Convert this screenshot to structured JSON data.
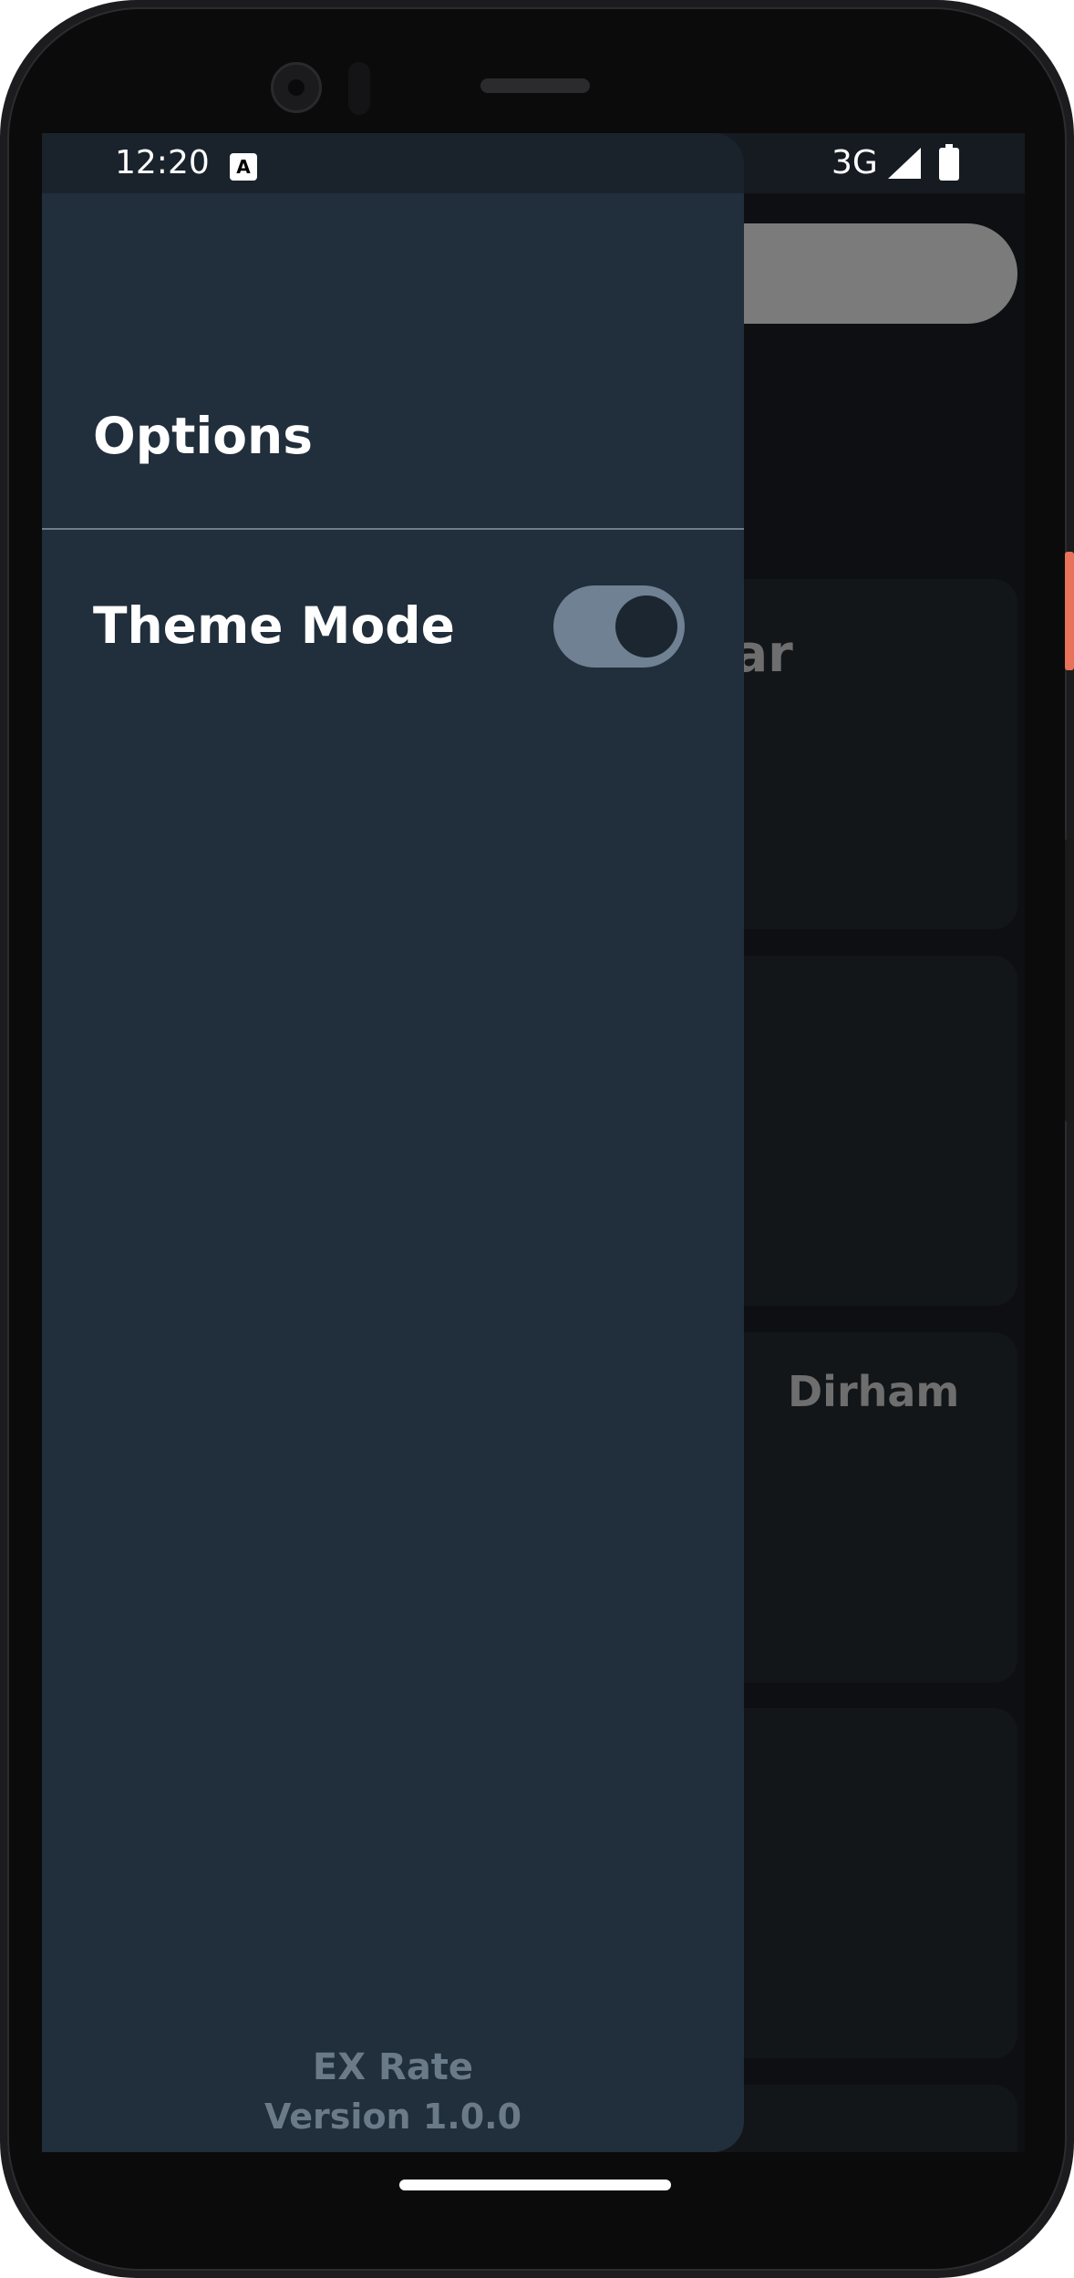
{
  "status_bar": {
    "time": "12:20",
    "network": "3G",
    "notification_icon": "a-icon",
    "signal_icon": "signal-icon",
    "battery_icon": "battery-icon"
  },
  "drawer": {
    "title": "Options",
    "theme_mode_label": "Theme Mode",
    "theme_toggle_on": true,
    "app_name": "EX Rate",
    "version": "Version 1.0.0"
  },
  "background": {
    "card1_partial": "llar",
    "card3_partial": "Dirham"
  },
  "colors": {
    "drawer_bg": "#212e3b",
    "toggle_track": "#6f8192",
    "toggle_knob": "#1c2630",
    "screen_bg": "#0d0f12"
  }
}
